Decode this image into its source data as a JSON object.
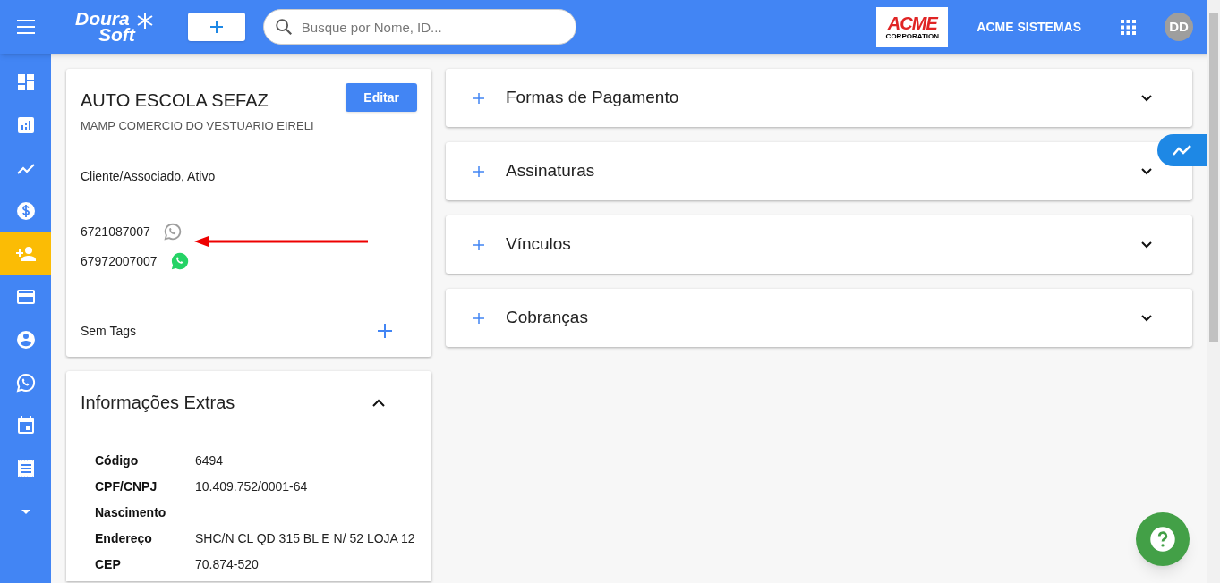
{
  "header": {
    "logo": {
      "line1": "Doura",
      "line2": "Soft"
    },
    "search": {
      "placeholder": "Busque por Nome, ID..."
    },
    "company_logo": {
      "name": "ACME",
      "subtitle": "CORPORATION"
    },
    "company": "ACME SISTEMAS",
    "avatar": "DD"
  },
  "sidebar": {
    "items": [
      {
        "kind": "dashboard",
        "selected": false
      },
      {
        "kind": "report",
        "selected": false
      },
      {
        "kind": "trend",
        "selected": false
      },
      {
        "kind": "money",
        "selected": false
      },
      {
        "kind": "add-person",
        "selected": true
      },
      {
        "kind": "card",
        "selected": false
      },
      {
        "kind": "account",
        "selected": false
      },
      {
        "kind": "whatsapp",
        "selected": false
      },
      {
        "kind": "calendar",
        "selected": false
      },
      {
        "kind": "receipt",
        "selected": false
      },
      {
        "kind": "more",
        "selected": false
      }
    ]
  },
  "client": {
    "name": "AUTO ESCOLA SEFAZ",
    "company": "MAMP COMERCIO DO VESTUARIO EIRELI",
    "edit_button": "Editar",
    "status": "Cliente/Associado, Ativo",
    "phones": [
      {
        "number": "6721087007",
        "whatsapp_active": false
      },
      {
        "number": "67972007007",
        "whatsapp_active": true
      }
    ],
    "tags": "Sem Tags"
  },
  "extras": {
    "title": "Informações Extras",
    "expanded": true,
    "rows": [
      {
        "label": "Código",
        "value": "6494"
      },
      {
        "label": "CPF/CNPJ",
        "value": "10.409.752/0001-64"
      },
      {
        "label": "Nascimento",
        "value": ""
      },
      {
        "label": "Endereço",
        "value": "SHC/N CL QD 315 BL E N/ 52 LOJA 12"
      },
      {
        "label": "CEP",
        "value": "70.874-520"
      }
    ]
  },
  "sections": [
    {
      "title": "Formas de Pagamento",
      "expanded": false
    },
    {
      "title": "Assinaturas",
      "expanded": false
    },
    {
      "title": "Vínculos",
      "expanded": false
    },
    {
      "title": "Cobranças",
      "expanded": false
    }
  ]
}
